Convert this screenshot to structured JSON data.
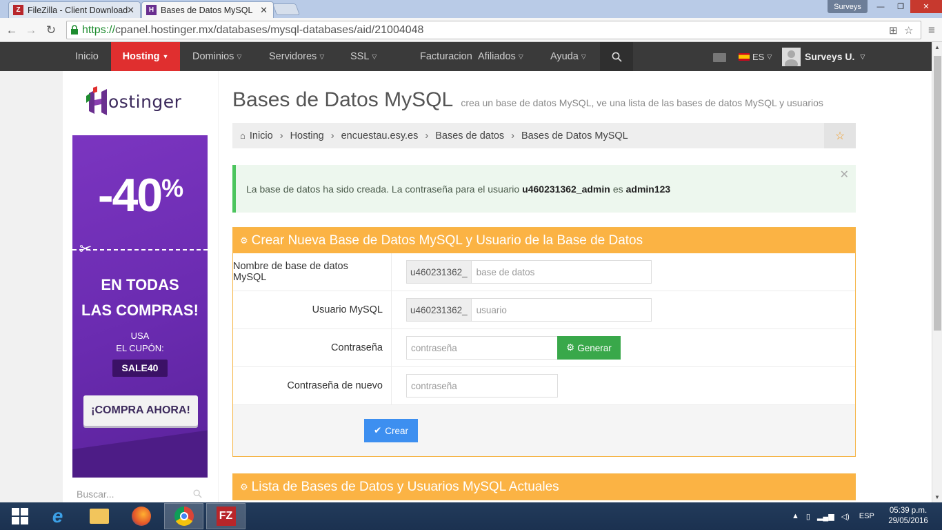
{
  "browser": {
    "tabs": [
      {
        "title": "FileZilla - Client Download",
        "active": false
      },
      {
        "title": "Bases de Datos MySQL",
        "active": true
      }
    ],
    "profile": "Surveys",
    "url_scheme": "https://",
    "url_rest": "cpanel.hostinger.mx/databases/mysql-databases/aid/21004048"
  },
  "topnav": {
    "items": [
      "Inicio",
      "Hosting",
      "Dominios",
      "Servidores",
      "SSL",
      "Facturacion",
      "Afiliados",
      "Ayuda"
    ],
    "language": "ES",
    "user": "Surveys U."
  },
  "sidebar": {
    "logo_text": "ostinger",
    "banner": {
      "discount": "-40",
      "percent": "%",
      "line1": "EN TODAS",
      "line2": "LAS COMPRAS!",
      "usa": "USA",
      "coupon_label": "EL CUPÓN:",
      "code": "SALE40",
      "cta": "¡COMPRA AHORA!"
    },
    "search_placeholder": "Buscar..."
  },
  "page": {
    "title": "Bases de Datos MySQL",
    "subtitle": "crea un base de datos MySQL, ve una lista de las bases de datos MySQL y usuarios",
    "breadcrumb": [
      "Inicio",
      "Hosting",
      "encuestau.esy.es",
      "Bases de datos",
      "Bases de Datos MySQL"
    ],
    "alert": {
      "text1": "La base de datos ha sido creada. La contraseña para el usuario",
      "user": "u460231362_admin",
      "text2": "es",
      "password": "admin123"
    },
    "create_panel": {
      "title": "Crear Nueva Base de Datos MySQL y Usuario de la Base de Datos",
      "db_label": "Nombre de base de datos MySQL",
      "db_prefix": "u460231362_",
      "db_placeholder": "base de datos",
      "user_label": "Usuario MySQL",
      "user_prefix": "u460231362_",
      "user_placeholder": "usuario",
      "pass_label": "Contraseña",
      "pass_placeholder": "contraseña",
      "generate_label": "Generar",
      "pass2_label": "Contraseña de nuevo",
      "pass2_placeholder": "contraseña",
      "submit_label": "Crear"
    },
    "list_panel": {
      "title": "Lista de Bases de Datos y Usuarios MySQL Actuales"
    }
  },
  "taskbar": {
    "lang": "ESP",
    "time": "05:39 p.m.",
    "date": "29/05/2016"
  },
  "colors": {
    "nav_active": "#e02f2f",
    "panel_header": "#fbb344",
    "success": "#4cc55e",
    "generate": "#39a84a",
    "submit": "#3d8ff0"
  }
}
